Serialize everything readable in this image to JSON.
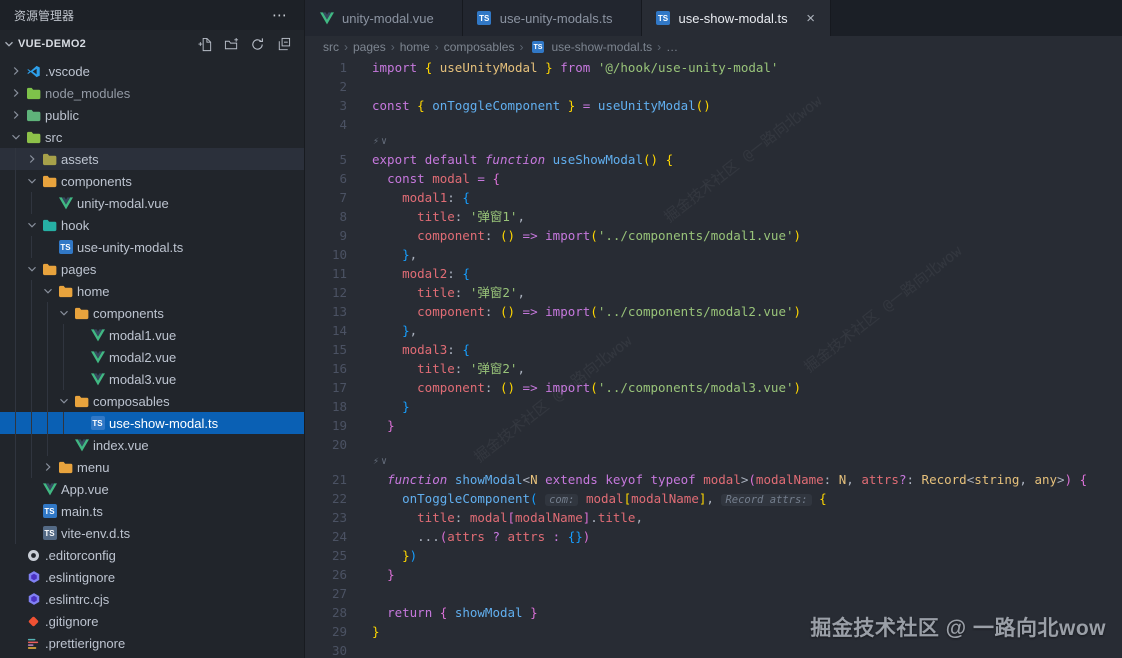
{
  "explorer_title": "资源管理器",
  "titlebar_more": "⋯",
  "project": {
    "name": "VUE-DEMO2",
    "actions": [
      "new-file-icon",
      "new-folder-icon",
      "refresh-icon",
      "collapse-all-icon"
    ]
  },
  "tree": [
    {
      "label": ".vscode",
      "level": 0,
      "expand": "collapsed",
      "icon": "vscode"
    },
    {
      "label": "node_modules",
      "level": 0,
      "expand": "collapsed",
      "icon": "folder",
      "iconColor": "#7ec24a",
      "dim": true
    },
    {
      "label": "public",
      "level": 0,
      "expand": "collapsed",
      "icon": "folder",
      "iconColor": "#5fb37a"
    },
    {
      "label": "src",
      "level": 0,
      "expand": "expanded",
      "icon": "folder",
      "iconColor": "#8dc149"
    },
    {
      "label": "assets",
      "level": 1,
      "expand": "collapsed",
      "icon": "folder",
      "iconColor": "#a7a14a",
      "hover": true
    },
    {
      "label": "components",
      "level": 1,
      "expand": "expanded",
      "icon": "folder",
      "iconColor": "#e8a33d"
    },
    {
      "label": "unity-modal.vue",
      "level": 2,
      "icon": "vue"
    },
    {
      "label": "hook",
      "level": 1,
      "expand": "expanded",
      "icon": "folder",
      "iconColor": "#26b0a4"
    },
    {
      "label": "use-unity-modal.ts",
      "level": 2,
      "icon": "ts"
    },
    {
      "label": "pages",
      "level": 1,
      "expand": "expanded",
      "icon": "folder",
      "iconColor": "#e8a33d"
    },
    {
      "label": "home",
      "level": 2,
      "expand": "expanded",
      "icon": "folder",
      "iconColor": "#e8a33d"
    },
    {
      "label": "components",
      "level": 3,
      "expand": "expanded",
      "icon": "folder",
      "iconColor": "#e8a33d"
    },
    {
      "label": "modal1.vue",
      "level": 4,
      "icon": "vue"
    },
    {
      "label": "modal2.vue",
      "level": 4,
      "icon": "vue"
    },
    {
      "label": "modal3.vue",
      "level": 4,
      "icon": "vue"
    },
    {
      "label": "composables",
      "level": 3,
      "expand": "expanded",
      "icon": "folder",
      "iconColor": "#e8a33d"
    },
    {
      "label": "use-show-modal.ts",
      "level": 4,
      "icon": "ts",
      "selected": true
    },
    {
      "label": "index.vue",
      "level": 3,
      "icon": "vue"
    },
    {
      "label": "menu",
      "level": 2,
      "expand": "collapsed",
      "icon": "folder",
      "iconColor": "#e8a33d"
    },
    {
      "label": "App.vue",
      "level": 1,
      "icon": "vue"
    },
    {
      "label": "main.ts",
      "level": 1,
      "icon": "ts"
    },
    {
      "label": "vite-env.d.ts",
      "level": 1,
      "icon": "dts"
    },
    {
      "label": ".editorconfig",
      "level": 0,
      "icon": "editorconfig"
    },
    {
      "label": ".eslintignore",
      "level": 0,
      "icon": "eslint"
    },
    {
      "label": ".eslintrc.cjs",
      "level": 0,
      "icon": "eslint"
    },
    {
      "label": ".gitignore",
      "level": 0,
      "icon": "git"
    },
    {
      "label": ".prettierignore",
      "level": 0,
      "icon": "prettier"
    }
  ],
  "tabs": [
    {
      "label": "unity-modal.vue",
      "icon": "vue",
      "active": false
    },
    {
      "label": "use-unity-modals.ts",
      "icon": "ts",
      "active": false
    },
    {
      "label": "use-show-modal.ts",
      "icon": "ts",
      "active": true,
      "close": "×"
    }
  ],
  "breadcrumb": [
    {
      "label": "src"
    },
    {
      "label": "pages"
    },
    {
      "label": "home"
    },
    {
      "label": "composables"
    },
    {
      "label": "use-show-modal.ts",
      "icon": "ts"
    },
    {
      "label": "…"
    }
  ],
  "code": {
    "deco_icon": "⚡∨",
    "lines": [
      {
        "n": 1,
        "t": [
          [
            "kw",
            "import"
          ],
          [
            "pun",
            " "
          ],
          [
            "b1",
            "{"
          ],
          [
            "pun",
            " "
          ],
          [
            "ty",
            "useUnityModal"
          ],
          [
            "pun",
            " "
          ],
          [
            "b1",
            "}"
          ],
          [
            "pun",
            " "
          ],
          [
            "kw",
            "from"
          ],
          [
            "pun",
            " "
          ],
          [
            "str",
            "'@/hook/use-unity-modal'"
          ]
        ]
      },
      {
        "n": 2,
        "t": []
      },
      {
        "n": 3,
        "t": [
          [
            "kw",
            "const"
          ],
          [
            "pun",
            " "
          ],
          [
            "b1",
            "{"
          ],
          [
            "pun",
            " "
          ],
          [
            "fn",
            "onToggleComponent"
          ],
          [
            "pun",
            " "
          ],
          [
            "b1",
            "}"
          ],
          [
            "pun",
            " "
          ],
          [
            "op",
            "="
          ],
          [
            "pun",
            " "
          ],
          [
            "fn",
            "useUnityModal"
          ],
          [
            "b1",
            "()"
          ]
        ]
      },
      {
        "n": 4,
        "t": []
      },
      {
        "deco": true
      },
      {
        "n": 5,
        "t": [
          [
            "kw",
            "export"
          ],
          [
            "pun",
            " "
          ],
          [
            "kw",
            "default"
          ],
          [
            "pun",
            " "
          ],
          [
            "kwi",
            "function"
          ],
          [
            "pun",
            " "
          ],
          [
            "fn",
            "useShowModal"
          ],
          [
            "b1",
            "()"
          ],
          [
            "pun",
            " "
          ],
          [
            "b1",
            "{"
          ]
        ]
      },
      {
        "n": 6,
        "t": [
          [
            "pun",
            "  "
          ],
          [
            "kw",
            "const"
          ],
          [
            "pun",
            " "
          ],
          [
            "vr",
            "modal"
          ],
          [
            "pun",
            " "
          ],
          [
            "op",
            "="
          ],
          [
            "pun",
            " "
          ],
          [
            "b2",
            "{"
          ]
        ]
      },
      {
        "n": 7,
        "t": [
          [
            "pun",
            "    "
          ],
          [
            "vr",
            "modal1"
          ],
          [
            "pun",
            ": "
          ],
          [
            "b3",
            "{"
          ]
        ]
      },
      {
        "n": 8,
        "t": [
          [
            "pun",
            "      "
          ],
          [
            "vr",
            "title"
          ],
          [
            "pun",
            ": "
          ],
          [
            "str",
            "'弹窗1'"
          ],
          [
            "pun",
            ","
          ]
        ]
      },
      {
        "n": 9,
        "t": [
          [
            "pun",
            "      "
          ],
          [
            "vr",
            "component"
          ],
          [
            "pun",
            ": "
          ],
          [
            "b1",
            "()"
          ],
          [
            "pun",
            " "
          ],
          [
            "op",
            "=>"
          ],
          [
            "pun",
            " "
          ],
          [
            "kw",
            "import"
          ],
          [
            "b1",
            "("
          ],
          [
            "str",
            "'../components/modal1.vue'"
          ],
          [
            "b1",
            ")"
          ]
        ]
      },
      {
        "n": 10,
        "t": [
          [
            "pun",
            "    "
          ],
          [
            "b3",
            "}"
          ],
          [
            "pun",
            ","
          ]
        ]
      },
      {
        "n": 11,
        "t": [
          [
            "pun",
            "    "
          ],
          [
            "vr",
            "modal2"
          ],
          [
            "pun",
            ": "
          ],
          [
            "b3",
            "{"
          ]
        ]
      },
      {
        "n": 12,
        "t": [
          [
            "pun",
            "      "
          ],
          [
            "vr",
            "title"
          ],
          [
            "pun",
            ": "
          ],
          [
            "str",
            "'弹窗2'"
          ],
          [
            "pun",
            ","
          ]
        ]
      },
      {
        "n": 13,
        "t": [
          [
            "pun",
            "      "
          ],
          [
            "vr",
            "component"
          ],
          [
            "pun",
            ": "
          ],
          [
            "b1",
            "()"
          ],
          [
            "pun",
            " "
          ],
          [
            "op",
            "=>"
          ],
          [
            "pun",
            " "
          ],
          [
            "kw",
            "import"
          ],
          [
            "b1",
            "("
          ],
          [
            "str",
            "'../components/modal2.vue'"
          ],
          [
            "b1",
            ")"
          ]
        ]
      },
      {
        "n": 14,
        "t": [
          [
            "pun",
            "    "
          ],
          [
            "b3",
            "}"
          ],
          [
            "pun",
            ","
          ]
        ]
      },
      {
        "n": 15,
        "t": [
          [
            "pun",
            "    "
          ],
          [
            "vr",
            "modal3"
          ],
          [
            "pun",
            ": "
          ],
          [
            "b3",
            "{"
          ]
        ]
      },
      {
        "n": 16,
        "t": [
          [
            "pun",
            "      "
          ],
          [
            "vr",
            "title"
          ],
          [
            "pun",
            ": "
          ],
          [
            "str",
            "'弹窗2'"
          ],
          [
            "pun",
            ","
          ]
        ]
      },
      {
        "n": 17,
        "t": [
          [
            "pun",
            "      "
          ],
          [
            "vr",
            "component"
          ],
          [
            "pun",
            ": "
          ],
          [
            "b1",
            "()"
          ],
          [
            "pun",
            " "
          ],
          [
            "op",
            "=>"
          ],
          [
            "pun",
            " "
          ],
          [
            "kw",
            "import"
          ],
          [
            "b1",
            "("
          ],
          [
            "str",
            "'../components/modal3.vue'"
          ],
          [
            "b1",
            ")"
          ]
        ]
      },
      {
        "n": 18,
        "t": [
          [
            "pun",
            "    "
          ],
          [
            "b3",
            "}"
          ]
        ]
      },
      {
        "n": 19,
        "t": [
          [
            "pun",
            "  "
          ],
          [
            "b2",
            "}"
          ]
        ]
      },
      {
        "n": 20,
        "t": []
      },
      {
        "deco": true
      },
      {
        "n": 21,
        "t": [
          [
            "pun",
            "  "
          ],
          [
            "kwi",
            "function"
          ],
          [
            "pun",
            " "
          ],
          [
            "fn",
            "showModal"
          ],
          [
            "pun",
            "<"
          ],
          [
            "ty",
            "N"
          ],
          [
            "pun",
            " "
          ],
          [
            "kw",
            "extends"
          ],
          [
            "pun",
            " "
          ],
          [
            "kw",
            "keyof"
          ],
          [
            "pun",
            " "
          ],
          [
            "kw",
            "typeof"
          ],
          [
            "pun",
            " "
          ],
          [
            "vr",
            "modal"
          ],
          [
            "pun",
            ">"
          ],
          [
            "b2",
            "("
          ],
          [
            "vr",
            "modalName"
          ],
          [
            "pun",
            ": "
          ],
          [
            "ty",
            "N"
          ],
          [
            "pun",
            ", "
          ],
          [
            "vr",
            "attrs"
          ],
          [
            "op",
            "?"
          ],
          [
            "pun",
            ": "
          ],
          [
            "ty",
            "Record"
          ],
          [
            "pun",
            "<"
          ],
          [
            "ty",
            "string"
          ],
          [
            "pun",
            ", "
          ],
          [
            "ty",
            "any"
          ],
          [
            "pun",
            ">"
          ],
          [
            "b2",
            ")"
          ],
          [
            "pun",
            " "
          ],
          [
            "b2",
            "{"
          ]
        ]
      },
      {
        "n": 22,
        "t": [
          [
            "pun",
            "    "
          ],
          [
            "fn",
            "onToggleComponent"
          ],
          [
            "b3",
            "("
          ],
          [
            "pun",
            " "
          ],
          [
            "hint",
            "com:"
          ],
          [
            "pun",
            " "
          ],
          [
            "vr",
            "modal"
          ],
          [
            "b1",
            "["
          ],
          [
            "vr",
            "modalName"
          ],
          [
            "b1",
            "]"
          ],
          [
            "pun",
            ", "
          ],
          [
            "hint",
            "Record attrs:"
          ],
          [
            "pun",
            " "
          ],
          [
            "b1",
            "{"
          ]
        ]
      },
      {
        "n": 23,
        "t": [
          [
            "pun",
            "      "
          ],
          [
            "vr",
            "title"
          ],
          [
            "pun",
            ": "
          ],
          [
            "vr",
            "modal"
          ],
          [
            "b2",
            "["
          ],
          [
            "vr",
            "modalName"
          ],
          [
            "b2",
            "]"
          ],
          [
            "pun",
            "."
          ],
          [
            "vr",
            "title"
          ],
          [
            "pun",
            ","
          ]
        ]
      },
      {
        "n": 24,
        "t": [
          [
            "pun",
            "      "
          ],
          [
            "pun",
            "..."
          ],
          [
            "b2",
            "("
          ],
          [
            "vr",
            "attrs"
          ],
          [
            "pun",
            " "
          ],
          [
            "op",
            "?"
          ],
          [
            "pun",
            " "
          ],
          [
            "vr",
            "attrs"
          ],
          [
            "pun",
            " "
          ],
          [
            "op",
            ":"
          ],
          [
            "pun",
            " "
          ],
          [
            "b3",
            "{}"
          ],
          [
            "b2",
            ")"
          ]
        ]
      },
      {
        "n": 25,
        "t": [
          [
            "pun",
            "    "
          ],
          [
            "b1",
            "}"
          ],
          [
            "b3",
            ")"
          ]
        ]
      },
      {
        "n": 26,
        "t": [
          [
            "pun",
            "  "
          ],
          [
            "b2",
            "}"
          ]
        ]
      },
      {
        "n": 27,
        "t": []
      },
      {
        "n": 28,
        "t": [
          [
            "pun",
            "  "
          ],
          [
            "kw",
            "return"
          ],
          [
            "pun",
            " "
          ],
          [
            "b2",
            "{"
          ],
          [
            "pun",
            " "
          ],
          [
            "fn",
            "showModal"
          ],
          [
            "pun",
            " "
          ],
          [
            "b2",
            "}"
          ]
        ]
      },
      {
        "n": 29,
        "t": [
          [
            "b1",
            "}"
          ]
        ]
      },
      {
        "n": 30,
        "t": []
      }
    ]
  },
  "watermark": {
    "main": "掘金技术社区 @ 一路向北wow",
    "faint": "掘金技术社区 @一路向北wow"
  }
}
